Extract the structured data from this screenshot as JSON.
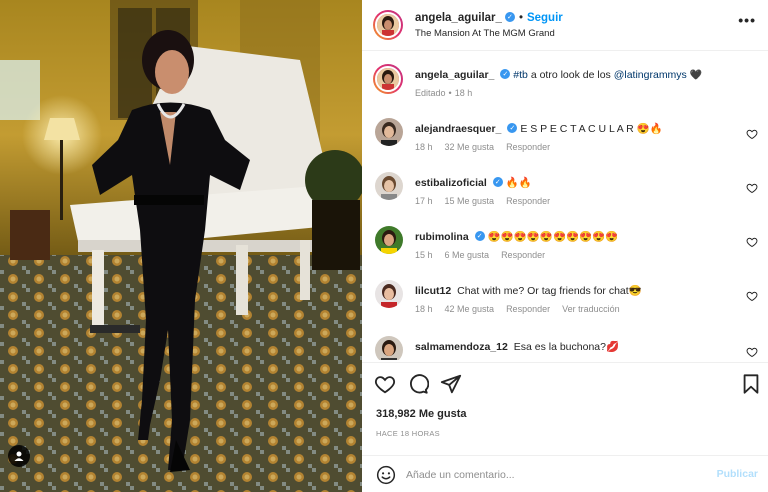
{
  "post": {
    "username": "angela_aguilar_",
    "follow_label": "Seguir",
    "separator": "•",
    "location": "The Mansion At The MGM Grand",
    "more_label": "•••"
  },
  "caption": {
    "username": "angela_aguilar_",
    "hashtag": "#tb",
    "text_mid": " a otro look de los ",
    "mention": "@latingrammys",
    "emoji": "🖤",
    "edited": "Editado",
    "time": "18 h"
  },
  "comments": [
    {
      "username": "alejandraesquer_",
      "verified": true,
      "text": "E S P E C T A C U L A R 😍🔥",
      "time": "18 h",
      "likes": "32 Me gusta",
      "reply": "Responder",
      "translate": ""
    },
    {
      "username": "estibalizoficial",
      "verified": true,
      "text": "🔥🔥",
      "time": "17 h",
      "likes": "15 Me gusta",
      "reply": "Responder",
      "translate": ""
    },
    {
      "username": "rubimolina",
      "verified": true,
      "text": "😍😍😍😍😍😍😍😍😍😍",
      "time": "15 h",
      "likes": "6 Me gusta",
      "reply": "Responder",
      "translate": ""
    },
    {
      "username": "lilcut12",
      "verified": false,
      "text": "Chat with me? Or tag friends for chat😎",
      "time": "18 h",
      "likes": "42 Me gusta",
      "reply": "Responder",
      "translate": "Ver traducción"
    },
    {
      "username": "salmamendoza_12",
      "verified": false,
      "text": "Esa es la buchona?💋",
      "time": "",
      "likes": "",
      "reply": "",
      "translate": ""
    }
  ],
  "stats": {
    "likes": "318,982 Me gusta",
    "time_ago": "HACE 18 HORAS"
  },
  "add_comment": {
    "placeholder": "Añade un comentario...",
    "publish_label": "Publicar"
  },
  "colors": {
    "accent": "#0095f6",
    "verified": "#3897f0",
    "muted": "#8e8e8e",
    "publish_disabled": "#b2dffc"
  },
  "icons": [
    "heart-icon",
    "comment-icon",
    "share-icon",
    "bookmark-icon",
    "emoji-icon",
    "more-icon",
    "tag-user-icon",
    "verified-icon"
  ]
}
